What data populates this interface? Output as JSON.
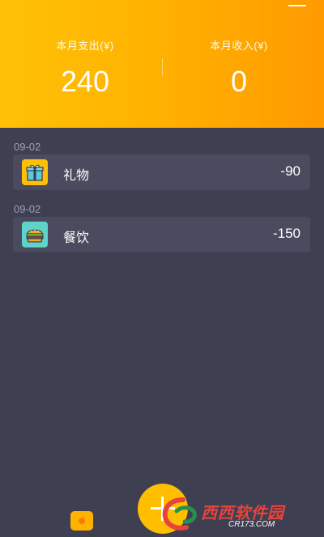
{
  "header": {
    "expense_label": "本月支出(¥)",
    "expense_value": "240",
    "income_label": "本月收入(¥)",
    "income_value": "0"
  },
  "records": [
    {
      "date": "09-02",
      "icon": "gift-icon",
      "name": "礼物",
      "amount": "-90",
      "icon_color": "#ffc107"
    },
    {
      "date": "09-02",
      "icon": "burger-icon",
      "name": "餐饮",
      "amount": "-150",
      "icon_color": "#5fd3c9"
    }
  ],
  "bottom_bar": {
    "left_icon": "wallet-icon",
    "add_icon": "plus-icon"
  },
  "watermark": {
    "text": "西西软件园",
    "sub": "CR173.COM"
  },
  "colors": {
    "header_start": "#ffc107",
    "header_end": "#ff9a00",
    "background": "#3f3f52",
    "card": "#4a4b5e",
    "accent": "#ffbe00"
  }
}
